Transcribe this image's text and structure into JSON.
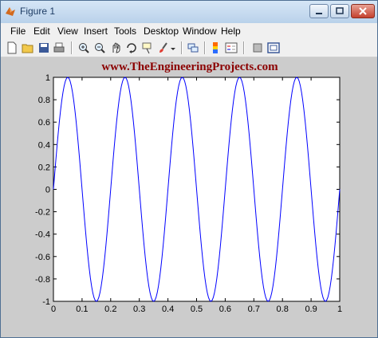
{
  "window": {
    "title": "Figure 1"
  },
  "menu": [
    "File",
    "Edit",
    "View",
    "Insert",
    "Tools",
    "Desktop",
    "Window",
    "Help"
  ],
  "toolbar": {
    "icons": [
      "new-figure-icon",
      "open-file-icon",
      "save-icon",
      "print-icon",
      "zoom-in-icon",
      "zoom-out-icon",
      "pan-icon",
      "rotate-3d-icon",
      "data-cursor-icon",
      "brush-icon",
      "link-plot-icon",
      "insert-colorbar-icon",
      "insert-legend-icon",
      "hide-plot-tools-icon",
      "show-plot-tools-icon"
    ]
  },
  "colors": {
    "title": "#8b0000",
    "line": "#0000ff",
    "figure_background": "#cccccc",
    "axes_background": "#ffffff"
  },
  "chart_data": {
    "type": "line",
    "title": "www.TheEngineeringProjects.com",
    "xlabel": "",
    "ylabel": "",
    "xlim": [
      0,
      1
    ],
    "ylim": [
      -1,
      1
    ],
    "xticks": [
      "0",
      "0.1",
      "0.2",
      "0.3",
      "0.4",
      "0.5",
      "0.6",
      "0.7",
      "0.8",
      "0.9",
      "1"
    ],
    "yticks": [
      "-1",
      "-0.8",
      "-0.6",
      "-0.4",
      "-0.2",
      "0",
      "0.2",
      "0.4",
      "0.6",
      "0.8",
      "1"
    ],
    "grid": false,
    "legend": "none",
    "series": [
      {
        "x": [
          0,
          0.025,
          0.05,
          0.075,
          0.1,
          0.125,
          0.15,
          0.175,
          0.2,
          0.225,
          0.25,
          0.275,
          0.3,
          0.325,
          0.35,
          0.375,
          0.4,
          0.425,
          0.45,
          0.475,
          0.5,
          0.525,
          0.55,
          0.575,
          0.6,
          0.625,
          0.65,
          0.675,
          0.7,
          0.725,
          0.75,
          0.775,
          0.8,
          0.825,
          0.85,
          0.875,
          0.9,
          0.925,
          0.95,
          0.975,
          1
        ],
        "y": [
          0,
          0.71,
          1,
          0.71,
          0,
          -0.71,
          -1,
          -0.71,
          0,
          0.71,
          1,
          0.71,
          0,
          -0.71,
          -1,
          -0.71,
          0,
          0.71,
          1,
          0.71,
          0,
          -0.71,
          -1,
          -0.71,
          0,
          0.71,
          1,
          0.71,
          0,
          -0.71,
          -1,
          -0.71,
          0,
          0.71,
          1,
          0.71,
          0,
          -0.71,
          -1,
          -0.71,
          0
        ]
      }
    ]
  }
}
